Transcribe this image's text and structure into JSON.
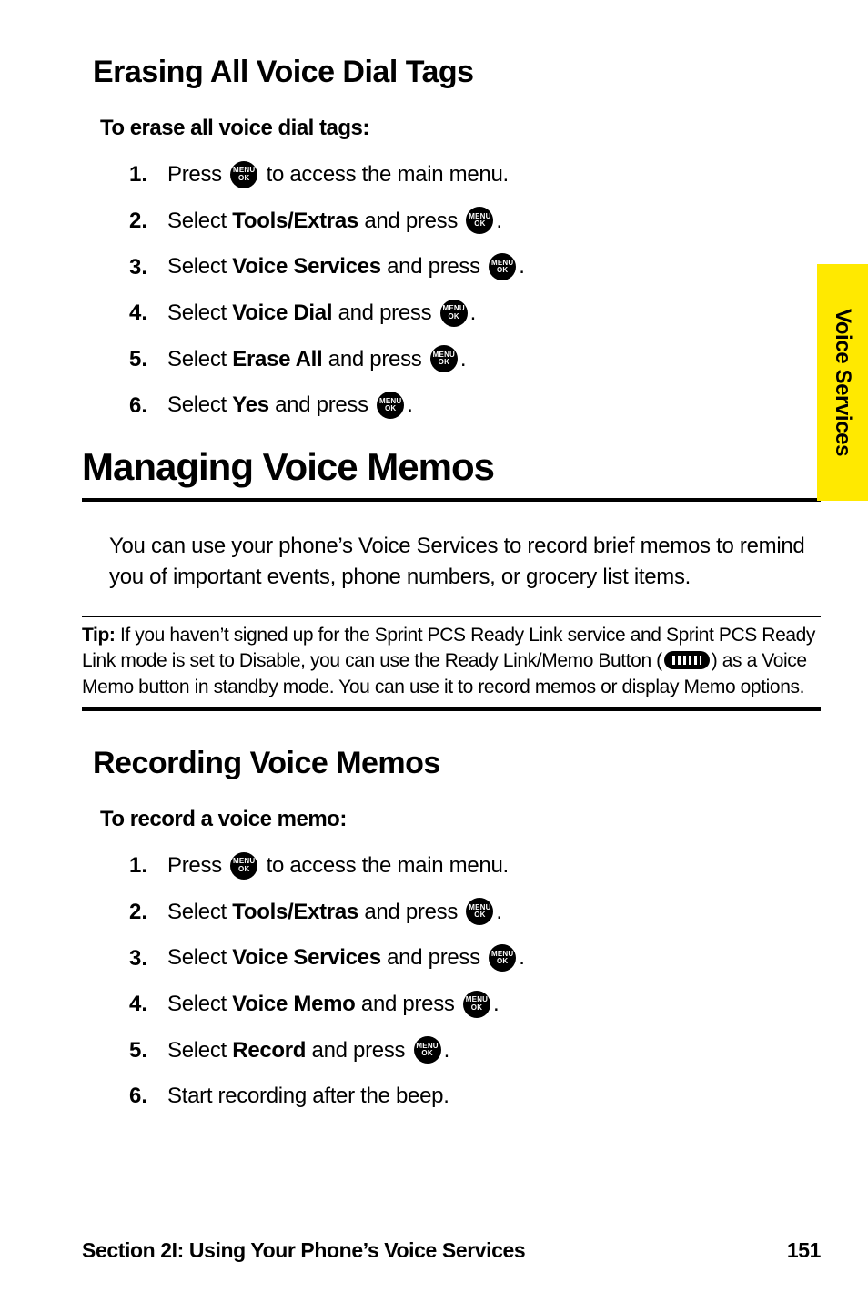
{
  "sideTab": {
    "label": "Voice Services"
  },
  "section1": {
    "heading": "Erasing All Voice Dial Tags",
    "subtitle": "To erase all voice dial tags:",
    "steps": [
      {
        "num": "1.",
        "pre": "Press ",
        "bold": "",
        "post": " to access the main menu.",
        "icon": "menu-ok"
      },
      {
        "num": "2.",
        "pre": "Select ",
        "bold": "Tools/Extras",
        "post": " and press ",
        "icon": "menu-ok",
        "trail": "."
      },
      {
        "num": "3.",
        "pre": "Select ",
        "bold": "Voice Services",
        "post": " and press ",
        "icon": "menu-ok",
        "trail": "."
      },
      {
        "num": "4.",
        "pre": "Select ",
        "bold": "Voice Dial",
        "post": " and press ",
        "icon": "menu-ok",
        "trail": "."
      },
      {
        "num": "5.",
        "pre": "Select ",
        "bold": "Erase All",
        "post": " and press ",
        "icon": "menu-ok",
        "trail": "."
      },
      {
        "num": "6.",
        "pre": "Select ",
        "bold": "Yes",
        "post": " and press ",
        "icon": "menu-ok",
        "trail": "."
      }
    ]
  },
  "mainHeading": "Managing Voice Memos",
  "bodyPara": "You can use your phone’s Voice Services to record brief memos to remind you of important events, phone numbers, or grocery list items.",
  "tip": {
    "label": "Tip:",
    "textPre": " If you haven’t signed up for the Sprint PCS Ready Link service and Sprint PCS Ready Link mode is set to Disable, you can use the Ready Link/Memo Button (",
    "textPost": ") as a Voice Memo button in standby mode. You can use it to record memos or display Memo options."
  },
  "section2": {
    "heading": "Recording Voice Memos",
    "subtitle": "To record a voice memo:",
    "steps": [
      {
        "num": "1.",
        "pre": "Press ",
        "bold": "",
        "post": " to access the main menu.",
        "icon": "menu-ok"
      },
      {
        "num": "2.",
        "pre": "Select ",
        "bold": "Tools/Extras",
        "post": " and press ",
        "icon": "menu-ok",
        "trail": "."
      },
      {
        "num": "3.",
        "pre": "Select ",
        "bold": "Voice Services",
        "post": " and press ",
        "icon": "menu-ok",
        "trail": "."
      },
      {
        "num": "4.",
        "pre": "Select ",
        "bold": "Voice Memo",
        "post": " and press ",
        "icon": "menu-ok",
        "trail": "."
      },
      {
        "num": "5.",
        "pre": "Select ",
        "bold": "Record",
        "post": " and press ",
        "icon": "menu-ok",
        "trail": "."
      },
      {
        "num": "6.",
        "pre": "Start recording after the beep.",
        "bold": "",
        "post": "",
        "icon": ""
      }
    ]
  },
  "footer": {
    "left": "Section 2I: Using Your Phone’s Voice Services",
    "right": "151"
  },
  "iconMenuOk": {
    "line1": "MENU",
    "line2": "OK"
  }
}
